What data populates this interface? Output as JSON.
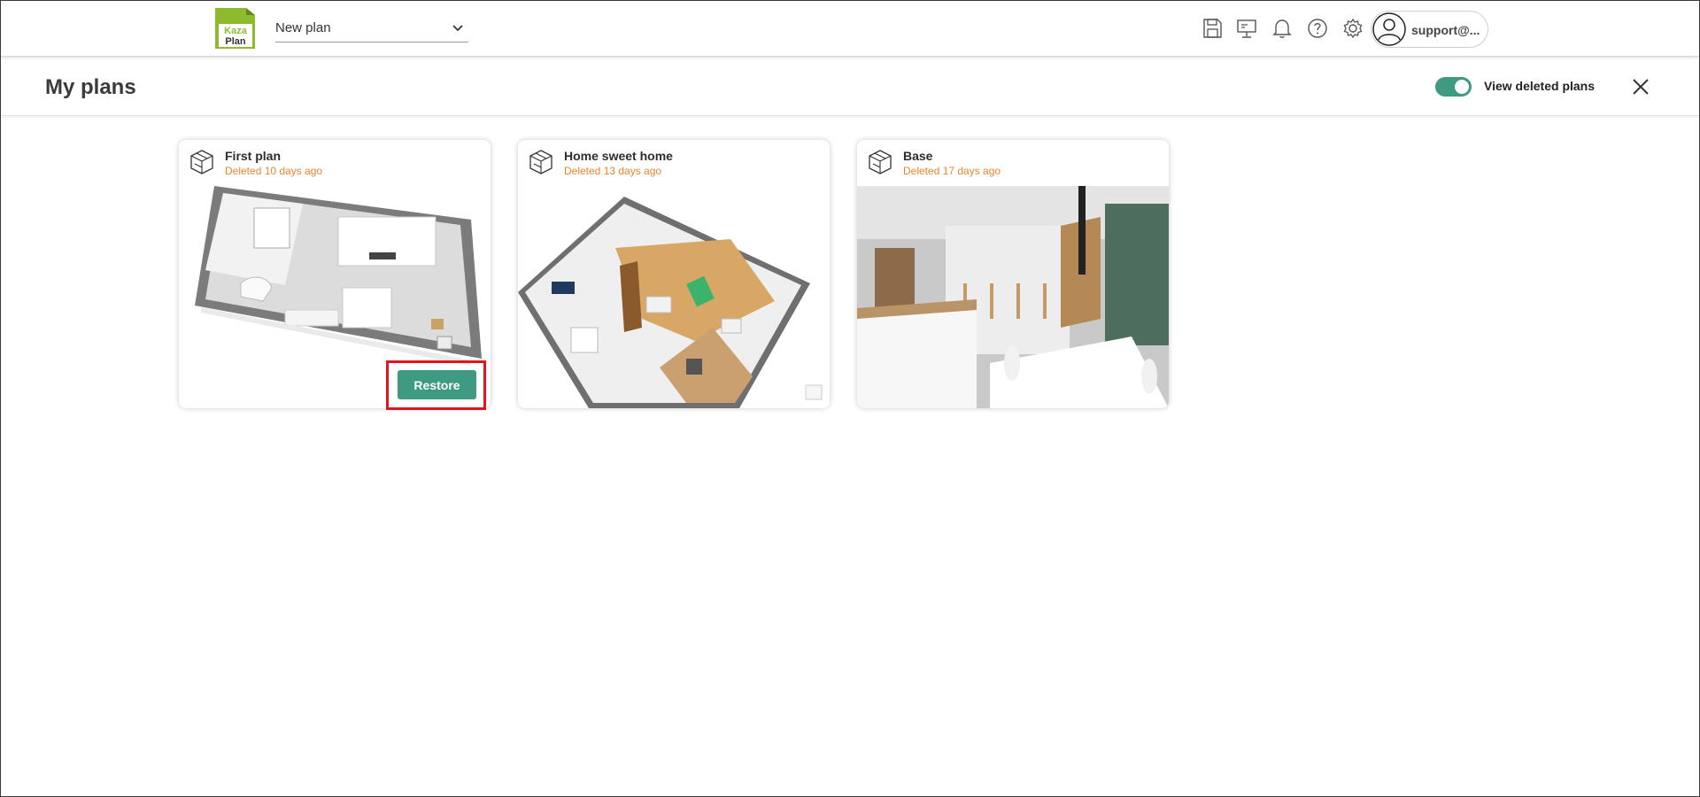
{
  "header": {
    "plan_selector": {
      "value": "New plan"
    },
    "icons": [
      "save-icon",
      "presentation-icon",
      "bell-icon",
      "help-icon",
      "gear-icon"
    ],
    "user": {
      "name": "support@..."
    },
    "logo_text": [
      "Kaza",
      "Plan"
    ]
  },
  "page": {
    "title": "My plans",
    "toggle": {
      "label": "View deleted plans",
      "checked": true
    }
  },
  "plans": [
    {
      "name": "First plan",
      "status": "Deleted 10 days ago",
      "action": "Restore"
    },
    {
      "name": "Home sweet home",
      "status": "Deleted 13 days ago"
    },
    {
      "name": "Base",
      "status": "Deleted 17 days ago"
    }
  ],
  "colors": {
    "accent": "#3e9a81",
    "status": "#e8862d",
    "highlight": "#e0161c",
    "logo_green": "#8dbb2d"
  }
}
